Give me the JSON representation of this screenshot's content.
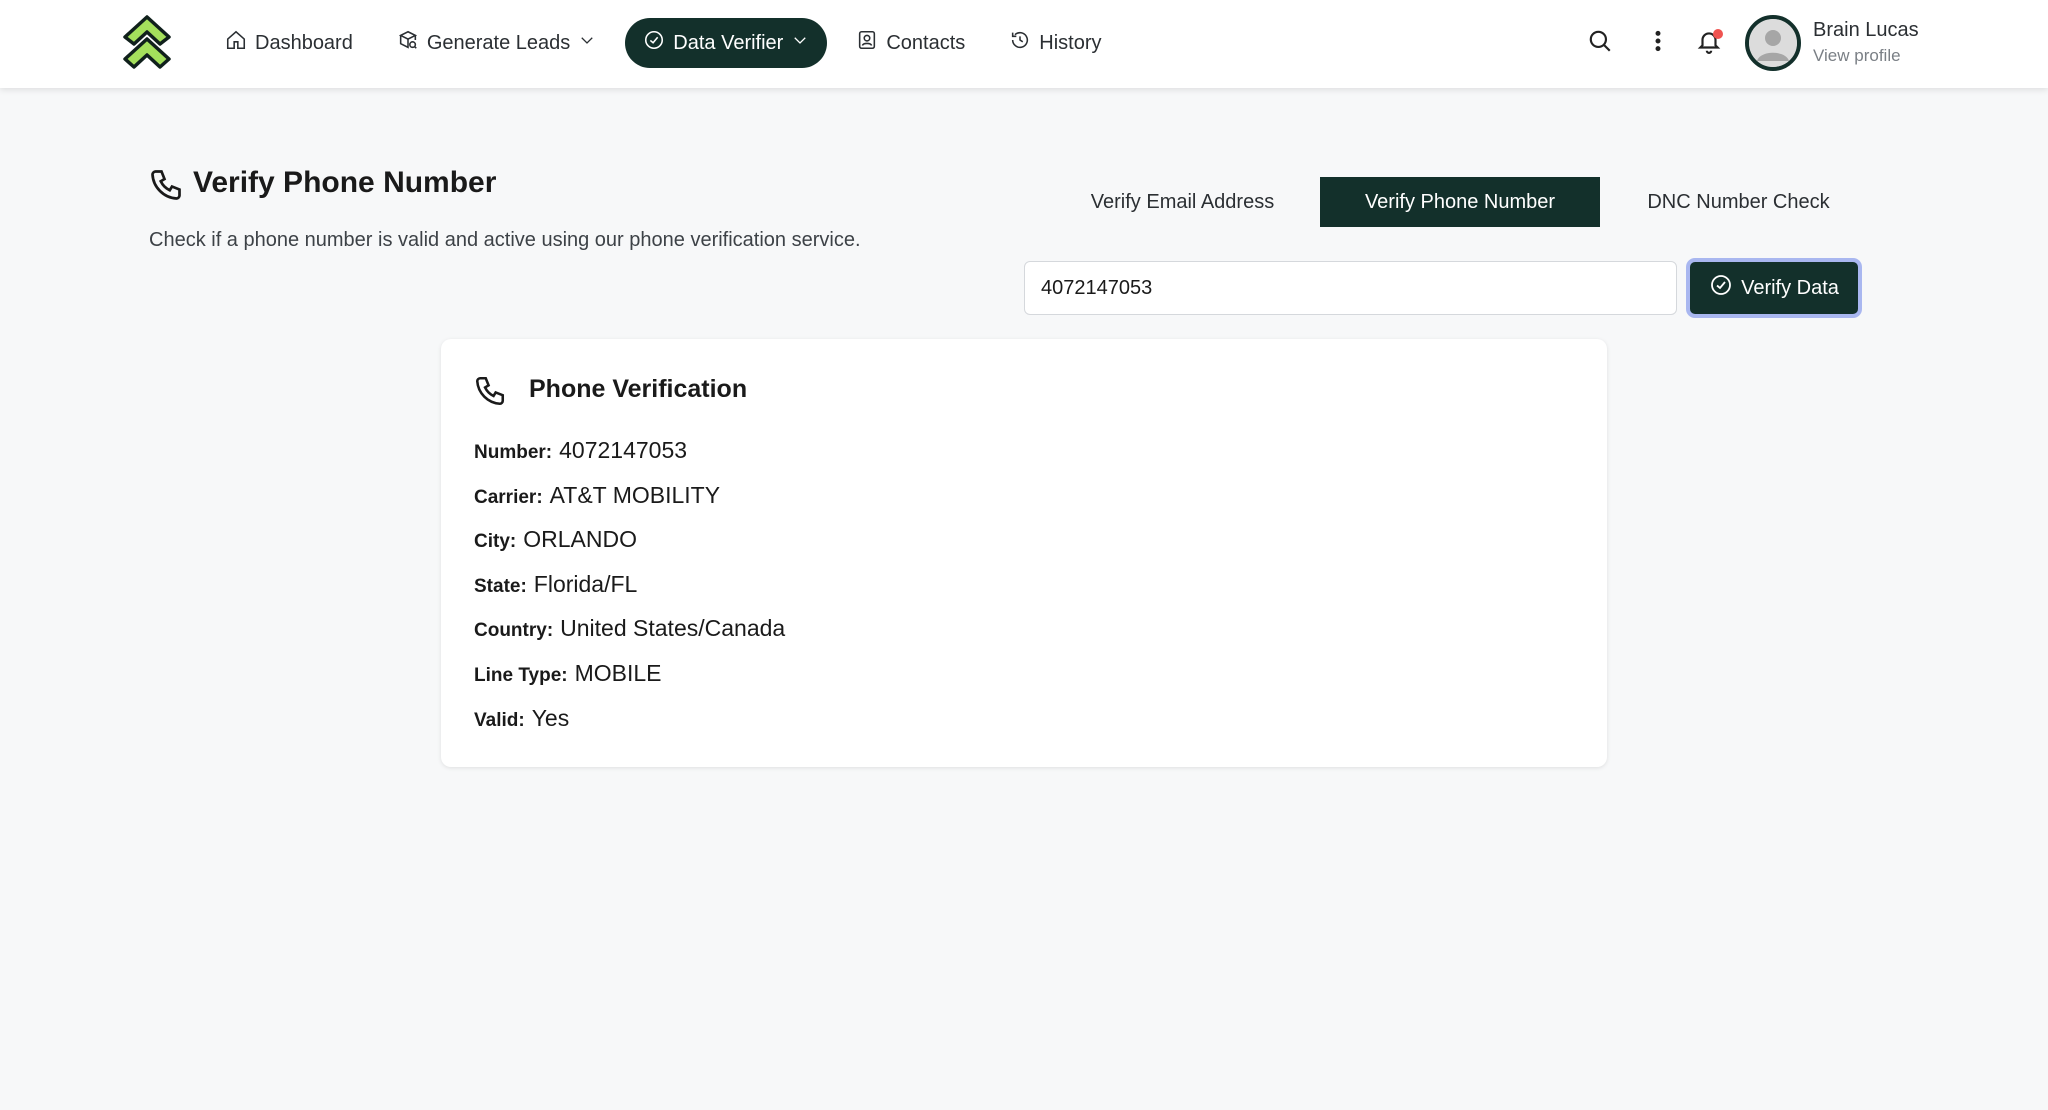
{
  "nav": {
    "items": [
      {
        "label": "Dashboard",
        "icon": "home-icon"
      },
      {
        "label": "Generate Leads",
        "icon": "leads-icon",
        "has_dropdown": true
      },
      {
        "label": "Data Verifier",
        "icon": "check-circle-icon",
        "has_dropdown": true,
        "active": true
      },
      {
        "label": "Contacts",
        "icon": "contacts-icon"
      },
      {
        "label": "History",
        "icon": "history-icon"
      }
    ]
  },
  "header_actions": {
    "search_icon": "search-icon",
    "more_icon": "more-vertical-icon",
    "bell_icon": "bell-icon",
    "has_notification": true
  },
  "profile": {
    "name": "Brain Lucas",
    "link": "View profile"
  },
  "page": {
    "title": "Verify Phone Number",
    "description": "Check if a phone number is valid and active using our phone verification service."
  },
  "tabs": [
    {
      "label": "Verify Email Address",
      "active": false
    },
    {
      "label": "Verify Phone Number",
      "active": true
    },
    {
      "label": "DNC Number Check",
      "active": false
    }
  ],
  "verify_form": {
    "input_value": "4072147053",
    "button_label": "Verify Data"
  },
  "result": {
    "title": "Phone Verification",
    "fields": [
      {
        "label": "Number:",
        "value": "4072147053"
      },
      {
        "label": "Carrier:",
        "value": "AT&T MOBILITY"
      },
      {
        "label": "City:",
        "value": "ORLANDO"
      },
      {
        "label": "State:",
        "value": "Florida/FL"
      },
      {
        "label": "Country:",
        "value": "United States/Canada"
      },
      {
        "label": "Line Type:",
        "value": "MOBILE"
      },
      {
        "label": "Valid:",
        "value": "Yes"
      }
    ]
  },
  "colors": {
    "accent_dark": "#13302b",
    "logo_green": "#a4e05c",
    "notification": "#ef5350",
    "focus_ring": "#a9b7f0"
  }
}
